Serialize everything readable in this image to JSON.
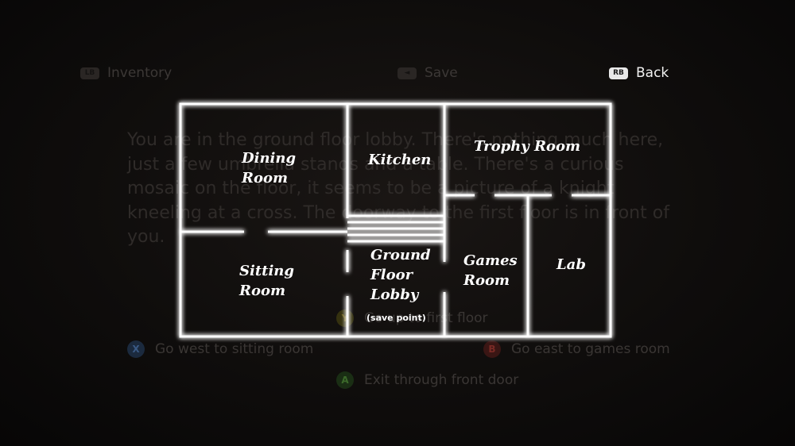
{
  "topbar": {
    "inventory": {
      "key": "LB",
      "label": "Inventory"
    },
    "save": {
      "key": "◄",
      "label": "Save"
    },
    "back": {
      "key": "RB",
      "label": "Back"
    }
  },
  "description": "You are in the ground floor lobby. There's nothing much here, just a few umbrella stands and a table. There's a curious mosaic on the floor, it seems to be a picture of a knight kneeling at a cross. The doorway to the first floor is in front of you.",
  "choices": {
    "west": {
      "key": "X",
      "label": "Go west to sitting room"
    },
    "east": {
      "key": "B",
      "label": "Go east to games room"
    },
    "up": {
      "key": "Y",
      "label": "Go up to first floor"
    },
    "exit": {
      "key": "A",
      "label": "Exit through front door"
    }
  },
  "map": {
    "rooms": {
      "dining": [
        "Dining",
        "Room"
      ],
      "kitchen": "Kitchen",
      "trophy": "Trophy Room",
      "sitting": [
        "Sitting",
        "Room"
      ],
      "lobby": [
        "Ground",
        "Floor",
        "Lobby"
      ],
      "lobby_note": "(save point)",
      "games": [
        "Games",
        "Room"
      ],
      "lab": "Lab"
    }
  },
  "colors": {
    "map_line": "#ffffff",
    "btn_x": "#1b2a3e",
    "btn_b": "#3a1614",
    "btn_y": "#35310f",
    "btn_a": "#1a2e14"
  }
}
